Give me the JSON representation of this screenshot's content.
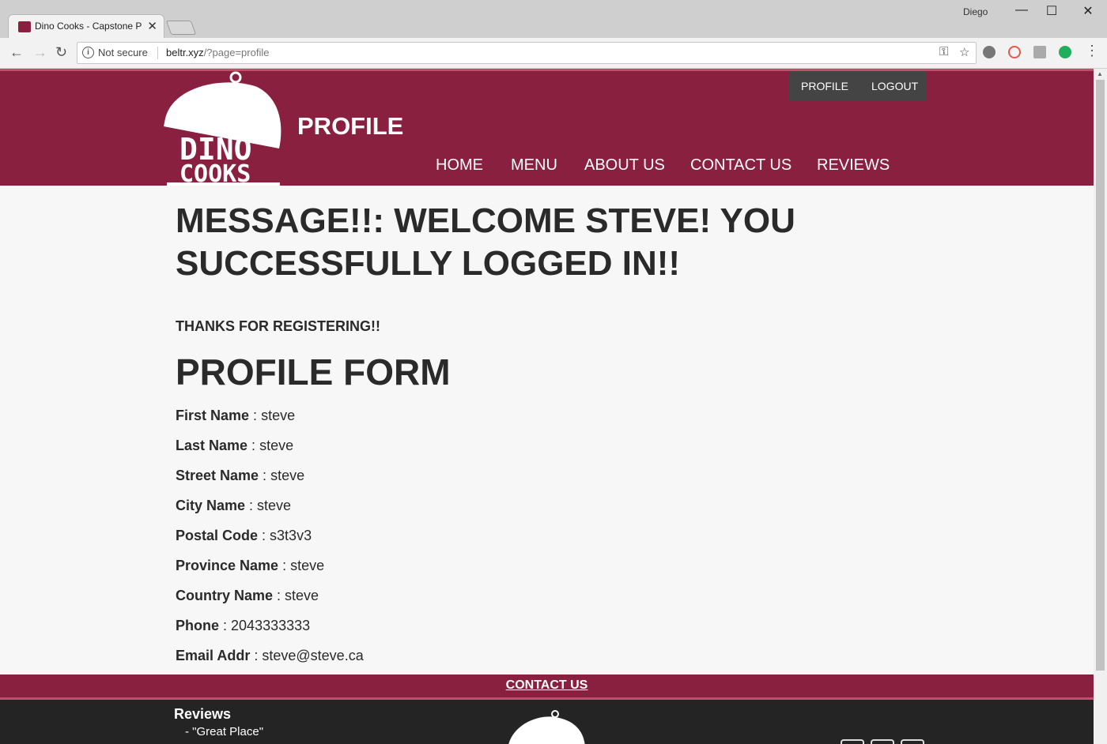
{
  "browser": {
    "tab_title": "Dino Cooks - Capstone P",
    "user": "Diego",
    "security_label": "Not secure",
    "url_host": "beltr.xyz",
    "url_path": "/?page=profile"
  },
  "header": {
    "logo_line1": "DINO",
    "logo_line2": "COOKS",
    "page_heading": "PROFILE",
    "top_links": [
      "PROFILE",
      "LOGOUT"
    ],
    "nav": [
      "HOME",
      "MENU",
      "ABOUT US",
      "CONTACT US",
      "REVIEWS"
    ]
  },
  "main": {
    "message_line1": "MESSAGE!!: WELCOME STEVE! YOU",
    "message_line2": "SUCCESSFULLY LOGGED IN!!",
    "thanks": "THANKS FOR REGISTERING!!",
    "form_title": "PROFILE FORM",
    "fields": [
      {
        "label": "First Name",
        "value": "steve"
      },
      {
        "label": "Last Name",
        "value": "steve"
      },
      {
        "label": "Street Name",
        "value": "steve"
      },
      {
        "label": "City Name",
        "value": "steve"
      },
      {
        "label": "Postal Code",
        "value": "s3t3v3"
      },
      {
        "label": "Province Name",
        "value": "steve"
      },
      {
        "label": "Country Name",
        "value": "steve"
      },
      {
        "label": "Phone",
        "value": "2043333333"
      },
      {
        "label": "Email Addr",
        "value": "steve@steve.ca"
      }
    ]
  },
  "footer": {
    "contact_link": "CONTACT US",
    "reviews_heading": "Reviews",
    "review_1": "- \"Great Place\""
  },
  "colors": {
    "brand": "#8a2040",
    "brand_accent": "#c0506a",
    "footer_bg": "#242424",
    "top_links_bg": "#444444"
  }
}
